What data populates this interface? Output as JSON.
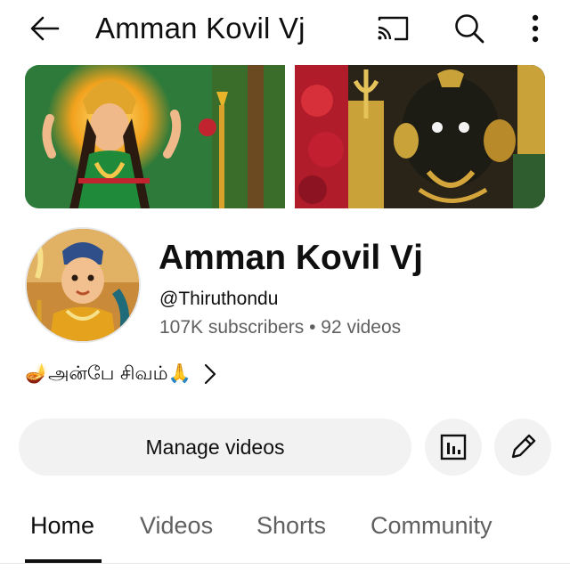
{
  "topbar": {
    "title": "Amman Kovil Vj",
    "icons": [
      "back-arrow-icon",
      "cast-icon",
      "search-icon",
      "more-vert-icon"
    ]
  },
  "banner": {
    "left_colors": [
      "#f6d04d",
      "#2f7d3a",
      "#c2242f"
    ],
    "right_colors": [
      "#8a1020",
      "#1c1a14",
      "#d4a53a"
    ]
  },
  "channel": {
    "name": "Amman Kovil Vj",
    "handle": "@Thiruthondu",
    "stats": "107K subscribers • 92 videos",
    "description": "🪔அன்பே சிவம்🙏"
  },
  "actions": {
    "manage_label": "Manage videos",
    "analytics_icon": "analytics-icon",
    "edit_icon": "pencil-icon"
  },
  "tabs": [
    {
      "label": "Home",
      "active": true
    },
    {
      "label": "Videos",
      "active": false
    },
    {
      "label": "Shorts",
      "active": false
    },
    {
      "label": "Community",
      "active": false
    }
  ],
  "colors": {
    "text_primary": "#0f0f0f",
    "text_secondary": "#606060",
    "button_bg": "#f2f2f2"
  }
}
